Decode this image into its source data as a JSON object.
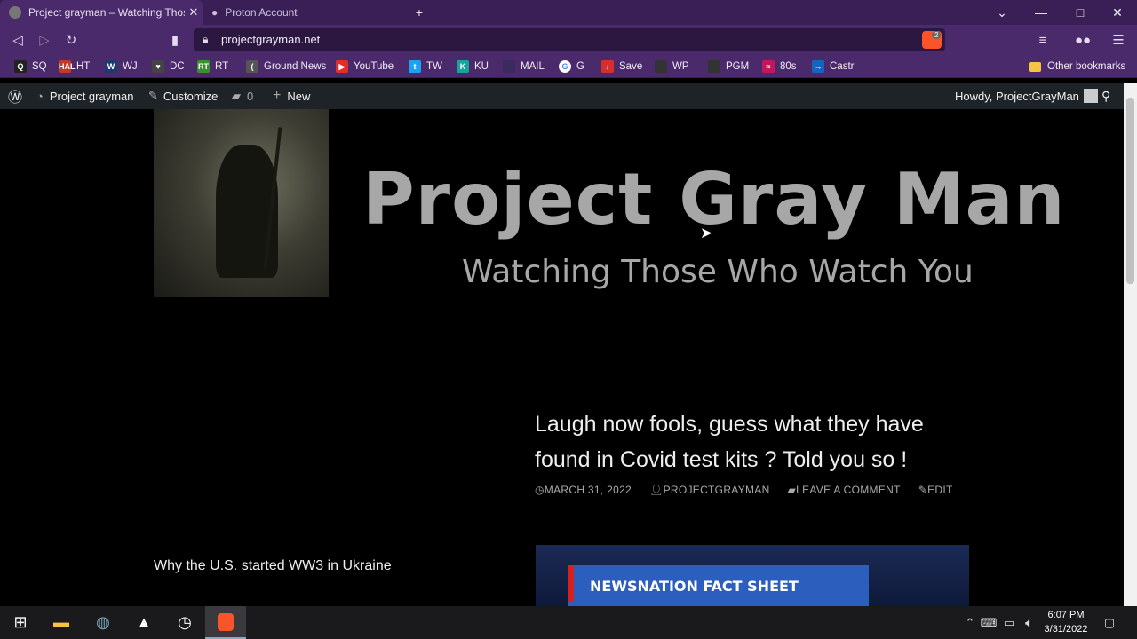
{
  "browser": {
    "tabs": [
      {
        "title": "Project grayman – Watching Thos",
        "active": true
      },
      {
        "title": "Proton Account",
        "active": false
      }
    ],
    "url": "projectgrayman.net",
    "brave_badge": "2",
    "bookmarks": [
      {
        "label": "SQ",
        "icon": "Q",
        "color": "#222"
      },
      {
        "label": "HT",
        "icon": "HAL",
        "color": "#c0392b"
      },
      {
        "label": "WJ",
        "icon": "W",
        "color": "#1f3a6e"
      },
      {
        "label": "DC",
        "icon": "♥",
        "color": "#444"
      },
      {
        "label": "RT",
        "icon": "RT",
        "color": "#3a8f2e"
      },
      {
        "label": "Ground News",
        "icon": "(",
        "color": "#555"
      },
      {
        "label": "YouTube",
        "icon": "▶",
        "color": "#e52d27"
      },
      {
        "label": "TW",
        "icon": "t",
        "color": "#1da1f2"
      },
      {
        "label": "KU",
        "icon": "K",
        "color": "#1aa39a"
      },
      {
        "label": "MAIL",
        "icon": "",
        "color": "#3b2a5c"
      },
      {
        "label": "G",
        "icon": "G",
        "color": "#ffffff"
      },
      {
        "label": "Save",
        "icon": "↓",
        "color": "#d32f2f"
      },
      {
        "label": "WP",
        "icon": "",
        "color": "#333"
      },
      {
        "label": "PGM",
        "icon": "",
        "color": "#333"
      },
      {
        "label": "80s",
        "icon": "≈",
        "color": "#c2185b"
      },
      {
        "label": "Castr",
        "icon": "→",
        "color": "#1565c0"
      }
    ],
    "other_bookmarks": "Other bookmarks"
  },
  "wpadmin": {
    "site": "Project grayman",
    "customize": "Customize",
    "comments": "0",
    "new": "New",
    "howdy": "Howdy, ProjectGrayMan"
  },
  "site": {
    "title": "Project Gray Man",
    "description": "Watching Those Who Watch You"
  },
  "post": {
    "title": "Laugh now fools, guess what they have found in Covid test kits ? Told you so !",
    "date": "MARCH 31, 2022",
    "author": "PROJECTGRAYMAN",
    "comment": "LEAVE A COMMENT",
    "edit": "EDIT",
    "featured_banner": "NEWSNATION FACT SHEET"
  },
  "sidebar": {
    "title": "Why the U.S. started WW3 in Ukraine"
  },
  "taskbar": {
    "time": "6:07 PM",
    "date": "3/31/2022"
  }
}
